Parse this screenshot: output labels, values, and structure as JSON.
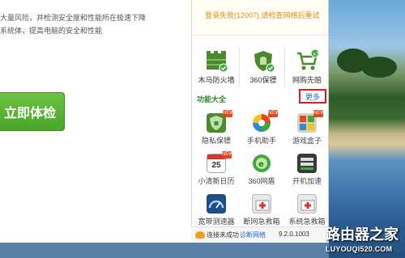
{
  "main": {
    "top_text": "",
    "desc_line1": "大量风险，并检测安全度和性能所在极速下降",
    "desc_line2": "系统体，提高电脑的安全和性能",
    "check_button": "立即体检"
  },
  "notice": {
    "fail_text": "登录失败(12007),",
    "link_text": "请检查网络后重试"
  },
  "top_tools": [
    {
      "label": "木马防火墙"
    },
    {
      "label": "360保镖"
    },
    {
      "label": "网购先赔"
    }
  ],
  "section": {
    "title": "功能大全",
    "more": "更多"
  },
  "tools": [
    {
      "label": "隐私保镖",
      "new": "NEW"
    },
    {
      "label": "手机助手",
      "new": "NEW"
    },
    {
      "label": "游戏盒子",
      "new": "NEW"
    },
    {
      "label": "小清新日历",
      "new": "NEW",
      "day": "25"
    },
    {
      "label": "360网盾",
      "new": ""
    },
    {
      "label": "开机加速",
      "new": ""
    },
    {
      "label": "宽带测速器",
      "new": ""
    },
    {
      "label": "断网急救箱",
      "new": ""
    },
    {
      "label": "系统急救箱",
      "new": ""
    }
  ],
  "status": {
    "connected": "连接未成功",
    "diagnose": "诊断网络",
    "version": "9.2.0.1003"
  },
  "watermark": {
    "line1": "路由器之家",
    "line2": "LUYOUQI520.COM"
  },
  "colors": {
    "accent_green": "#4aa52a",
    "notice_orange": "#f08a14",
    "highlight_red": "#d81e1e",
    "link_blue": "#2568b8"
  }
}
